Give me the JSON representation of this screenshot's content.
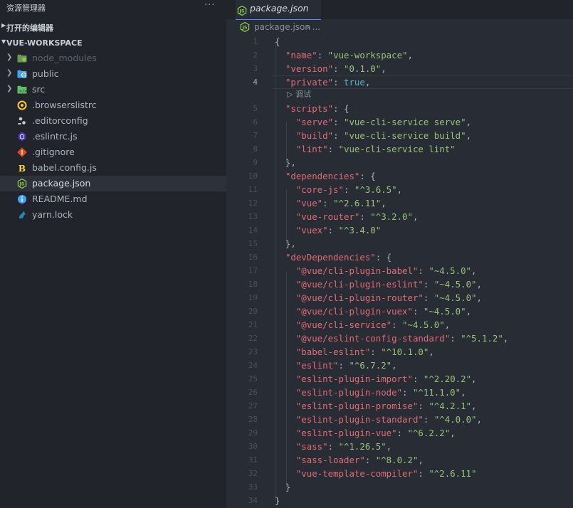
{
  "explorer": {
    "title": "资源管理器",
    "more_label": "···",
    "open_editors_label": "打开的编辑器",
    "workspace_label": "VUE-WORKSPACE",
    "items": [
      {
        "label": "node_modules",
        "kind": "folder",
        "icon": "node-folder-icon",
        "color": "#5c6370"
      },
      {
        "label": "public",
        "kind": "folder",
        "icon": "public-folder-icon",
        "color": "#abb2bf"
      },
      {
        "label": "src",
        "kind": "folder",
        "icon": "src-folder-icon",
        "color": "#abb2bf"
      },
      {
        "label": ".browserslistrc",
        "kind": "file",
        "icon": "browserslist-icon",
        "color": "#abb2bf"
      },
      {
        "label": ".editorconfig",
        "kind": "file",
        "icon": "editorconfig-icon",
        "color": "#abb2bf"
      },
      {
        "label": ".eslintrc.js",
        "kind": "file",
        "icon": "eslint-icon",
        "color": "#abb2bf"
      },
      {
        "label": ".gitignore",
        "kind": "file",
        "icon": "git-icon",
        "color": "#abb2bf"
      },
      {
        "label": "babel.config.js",
        "kind": "file",
        "icon": "babel-icon",
        "color": "#abb2bf"
      },
      {
        "label": "package.json",
        "kind": "file",
        "icon": "nodejs-icon",
        "color": "#d7dae0",
        "selected": true
      },
      {
        "label": "README.md",
        "kind": "file",
        "icon": "info-icon",
        "color": "#abb2bf"
      },
      {
        "label": "yarn.lock",
        "kind": "file",
        "icon": "yarn-icon",
        "color": "#abb2bf"
      }
    ]
  },
  "tab": {
    "label": "package.json",
    "icon": "nodejs-icon"
  },
  "breadcrumb": {
    "file": "package.json",
    "sep": "›",
    "more": "..."
  },
  "codelens": {
    "label": "调试",
    "icon": "play-icon"
  },
  "active_line": 4,
  "code_lines": [
    {
      "n": "1",
      "segs": [
        [
          "br",
          "{"
        ]
      ]
    },
    {
      "n": "2",
      "segs": [
        [
          "p",
          "  "
        ],
        [
          "k",
          "\"name\""
        ],
        [
          "p",
          ": "
        ],
        [
          "s",
          "\"vue-workspace\""
        ],
        [
          "p",
          ","
        ]
      ]
    },
    {
      "n": "3",
      "segs": [
        [
          "p",
          "  "
        ],
        [
          "k",
          "\"version\""
        ],
        [
          "p",
          ": "
        ],
        [
          "s",
          "\"0.1.0\""
        ],
        [
          "p",
          ","
        ]
      ]
    },
    {
      "n": "4",
      "segs": [
        [
          "p",
          "  "
        ],
        [
          "k",
          "\"private\""
        ],
        [
          "p",
          ": "
        ],
        [
          "kw",
          "true"
        ],
        [
          "p",
          ","
        ]
      ]
    },
    {
      "n": "5",
      "segs": [
        [
          "p",
          "  "
        ],
        [
          "k",
          "\"scripts\""
        ],
        [
          "p",
          ": {"
        ]
      ]
    },
    {
      "n": "6",
      "segs": [
        [
          "p",
          "    "
        ],
        [
          "k",
          "\"serve\""
        ],
        [
          "p",
          ": "
        ],
        [
          "s",
          "\"vue-cli-service serve\""
        ],
        [
          "p",
          ","
        ]
      ]
    },
    {
      "n": "7",
      "segs": [
        [
          "p",
          "    "
        ],
        [
          "k",
          "\"build\""
        ],
        [
          "p",
          ": "
        ],
        [
          "s",
          "\"vue-cli-service build\""
        ],
        [
          "p",
          ","
        ]
      ]
    },
    {
      "n": "8",
      "segs": [
        [
          "p",
          "    "
        ],
        [
          "k",
          "\"lint\""
        ],
        [
          "p",
          ": "
        ],
        [
          "s",
          "\"vue-cli-service lint\""
        ]
      ]
    },
    {
      "n": "9",
      "segs": [
        [
          "p",
          "  },"
        ]
      ]
    },
    {
      "n": "10",
      "segs": [
        [
          "p",
          "  "
        ],
        [
          "k",
          "\"dependencies\""
        ],
        [
          "p",
          ": {"
        ]
      ]
    },
    {
      "n": "11",
      "segs": [
        [
          "p",
          "    "
        ],
        [
          "k",
          "\"core-js\""
        ],
        [
          "p",
          ": "
        ],
        [
          "s",
          "\"^3.6.5\""
        ],
        [
          "p",
          ","
        ]
      ]
    },
    {
      "n": "12",
      "segs": [
        [
          "p",
          "    "
        ],
        [
          "k",
          "\"vue\""
        ],
        [
          "p",
          ": "
        ],
        [
          "s",
          "\"^2.6.11\""
        ],
        [
          "p",
          ","
        ]
      ]
    },
    {
      "n": "13",
      "segs": [
        [
          "p",
          "    "
        ],
        [
          "k",
          "\"vue-router\""
        ],
        [
          "p",
          ": "
        ],
        [
          "s",
          "\"^3.2.0\""
        ],
        [
          "p",
          ","
        ]
      ]
    },
    {
      "n": "14",
      "segs": [
        [
          "p",
          "    "
        ],
        [
          "k",
          "\"vuex\""
        ],
        [
          "p",
          ": "
        ],
        [
          "s",
          "\"^3.4.0\""
        ]
      ]
    },
    {
      "n": "15",
      "segs": [
        [
          "p",
          "  },"
        ]
      ]
    },
    {
      "n": "16",
      "segs": [
        [
          "p",
          "  "
        ],
        [
          "k",
          "\"devDependencies\""
        ],
        [
          "p",
          ": {"
        ]
      ]
    },
    {
      "n": "17",
      "segs": [
        [
          "p",
          "    "
        ],
        [
          "k",
          "\"@vue/cli-plugin-babel\""
        ],
        [
          "p",
          ": "
        ],
        [
          "s",
          "\"~4.5.0\""
        ],
        [
          "p",
          ","
        ]
      ]
    },
    {
      "n": "18",
      "segs": [
        [
          "p",
          "    "
        ],
        [
          "k",
          "\"@vue/cli-plugin-eslint\""
        ],
        [
          "p",
          ": "
        ],
        [
          "s",
          "\"~4.5.0\""
        ],
        [
          "p",
          ","
        ]
      ]
    },
    {
      "n": "19",
      "segs": [
        [
          "p",
          "    "
        ],
        [
          "k",
          "\"@vue/cli-plugin-router\""
        ],
        [
          "p",
          ": "
        ],
        [
          "s",
          "\"~4.5.0\""
        ],
        [
          "p",
          ","
        ]
      ]
    },
    {
      "n": "20",
      "segs": [
        [
          "p",
          "    "
        ],
        [
          "k",
          "\"@vue/cli-plugin-vuex\""
        ],
        [
          "p",
          ": "
        ],
        [
          "s",
          "\"~4.5.0\""
        ],
        [
          "p",
          ","
        ]
      ]
    },
    {
      "n": "21",
      "segs": [
        [
          "p",
          "    "
        ],
        [
          "k",
          "\"@vue/cli-service\""
        ],
        [
          "p",
          ": "
        ],
        [
          "s",
          "\"~4.5.0\""
        ],
        [
          "p",
          ","
        ]
      ]
    },
    {
      "n": "22",
      "segs": [
        [
          "p",
          "    "
        ],
        [
          "k",
          "\"@vue/eslint-config-standard\""
        ],
        [
          "p",
          ": "
        ],
        [
          "s",
          "\"^5.1.2\""
        ],
        [
          "p",
          ","
        ]
      ]
    },
    {
      "n": "23",
      "segs": [
        [
          "p",
          "    "
        ],
        [
          "k",
          "\"babel-eslint\""
        ],
        [
          "p",
          ": "
        ],
        [
          "s",
          "\"^10.1.0\""
        ],
        [
          "p",
          ","
        ]
      ]
    },
    {
      "n": "24",
      "segs": [
        [
          "p",
          "    "
        ],
        [
          "k",
          "\"eslint\""
        ],
        [
          "p",
          ": "
        ],
        [
          "s",
          "\"^6.7.2\""
        ],
        [
          "p",
          ","
        ]
      ]
    },
    {
      "n": "25",
      "segs": [
        [
          "p",
          "    "
        ],
        [
          "k",
          "\"eslint-plugin-import\""
        ],
        [
          "p",
          ": "
        ],
        [
          "s",
          "\"^2.20.2\""
        ],
        [
          "p",
          ","
        ]
      ]
    },
    {
      "n": "26",
      "segs": [
        [
          "p",
          "    "
        ],
        [
          "k",
          "\"eslint-plugin-node\""
        ],
        [
          "p",
          ": "
        ],
        [
          "s",
          "\"^11.1.0\""
        ],
        [
          "p",
          ","
        ]
      ]
    },
    {
      "n": "27",
      "segs": [
        [
          "p",
          "    "
        ],
        [
          "k",
          "\"eslint-plugin-promise\""
        ],
        [
          "p",
          ": "
        ],
        [
          "s",
          "\"^4.2.1\""
        ],
        [
          "p",
          ","
        ]
      ]
    },
    {
      "n": "28",
      "segs": [
        [
          "p",
          "    "
        ],
        [
          "k",
          "\"eslint-plugin-standard\""
        ],
        [
          "p",
          ": "
        ],
        [
          "s",
          "\"^4.0.0\""
        ],
        [
          "p",
          ","
        ]
      ]
    },
    {
      "n": "29",
      "segs": [
        [
          "p",
          "    "
        ],
        [
          "k",
          "\"eslint-plugin-vue\""
        ],
        [
          "p",
          ": "
        ],
        [
          "s",
          "\"^6.2.2\""
        ],
        [
          "p",
          ","
        ]
      ]
    },
    {
      "n": "30",
      "segs": [
        [
          "p",
          "    "
        ],
        [
          "k",
          "\"sass\""
        ],
        [
          "p",
          ": "
        ],
        [
          "s",
          "\"^1.26.5\""
        ],
        [
          "p",
          ","
        ]
      ]
    },
    {
      "n": "31",
      "segs": [
        [
          "p",
          "    "
        ],
        [
          "k",
          "\"sass-loader\""
        ],
        [
          "p",
          ": "
        ],
        [
          "s",
          "\"^8.0.2\""
        ],
        [
          "p",
          ","
        ]
      ]
    },
    {
      "n": "32",
      "segs": [
        [
          "p",
          "    "
        ],
        [
          "k",
          "\"vue-template-compiler\""
        ],
        [
          "p",
          ": "
        ],
        [
          "s",
          "\"^2.6.11\""
        ]
      ]
    },
    {
      "n": "33",
      "segs": [
        [
          "p",
          "  }"
        ]
      ]
    },
    {
      "n": "34",
      "segs": [
        [
          "br",
          "}"
        ]
      ]
    }
  ]
}
